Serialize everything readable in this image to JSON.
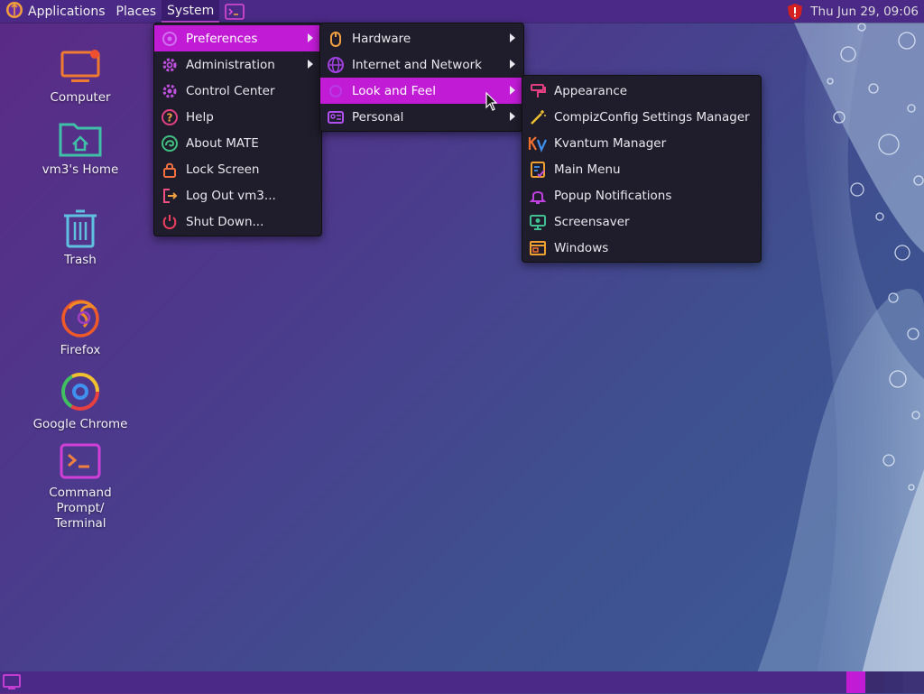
{
  "panel": {
    "applications": "Applications",
    "places": "Places",
    "system": "System",
    "clock": "Thu Jun 29, 09:06"
  },
  "desktop": [
    {
      "label": "Computer",
      "icon": "computer-icon"
    },
    {
      "label": "vm3's Home",
      "icon": "home-folder-icon"
    },
    {
      "label": "Trash",
      "icon": "trash-icon"
    },
    {
      "label": "Firefox",
      "icon": "firefox-icon"
    },
    {
      "label": "Google Chrome",
      "icon": "chrome-icon"
    },
    {
      "label": "Command Prompt/\nTerminal",
      "line1": "Command Prompt/",
      "line2": "Terminal",
      "icon": "terminal-icon"
    }
  ],
  "system_menu": [
    {
      "label": "Preferences",
      "submenu": true,
      "highlighted": true
    },
    {
      "label": "Administration",
      "submenu": true
    },
    {
      "label": "Control Center"
    },
    {
      "label": "Help"
    },
    {
      "label": "About MATE"
    },
    {
      "label": "Lock Screen"
    },
    {
      "label": "Log Out vm3..."
    },
    {
      "label": "Shut Down..."
    }
  ],
  "preferences_menu": [
    {
      "label": "Hardware",
      "submenu": true
    },
    {
      "label": "Internet and Network",
      "submenu": true
    },
    {
      "label": "Look and Feel",
      "submenu": true,
      "highlighted": true
    },
    {
      "label": "Personal",
      "submenu": true
    }
  ],
  "look_and_feel_menu": [
    {
      "label": "Appearance"
    },
    {
      "label": "CompizConfig Settings Manager"
    },
    {
      "label": "Kvantum Manager"
    },
    {
      "label": "Main Menu"
    },
    {
      "label": "Popup Notifications"
    },
    {
      "label": "Screensaver"
    },
    {
      "label": "Windows"
    }
  ],
  "colors": {
    "highlight": "#c21bd6",
    "panel": "#4a2a86",
    "menu_bg": "#1f1d2b"
  }
}
